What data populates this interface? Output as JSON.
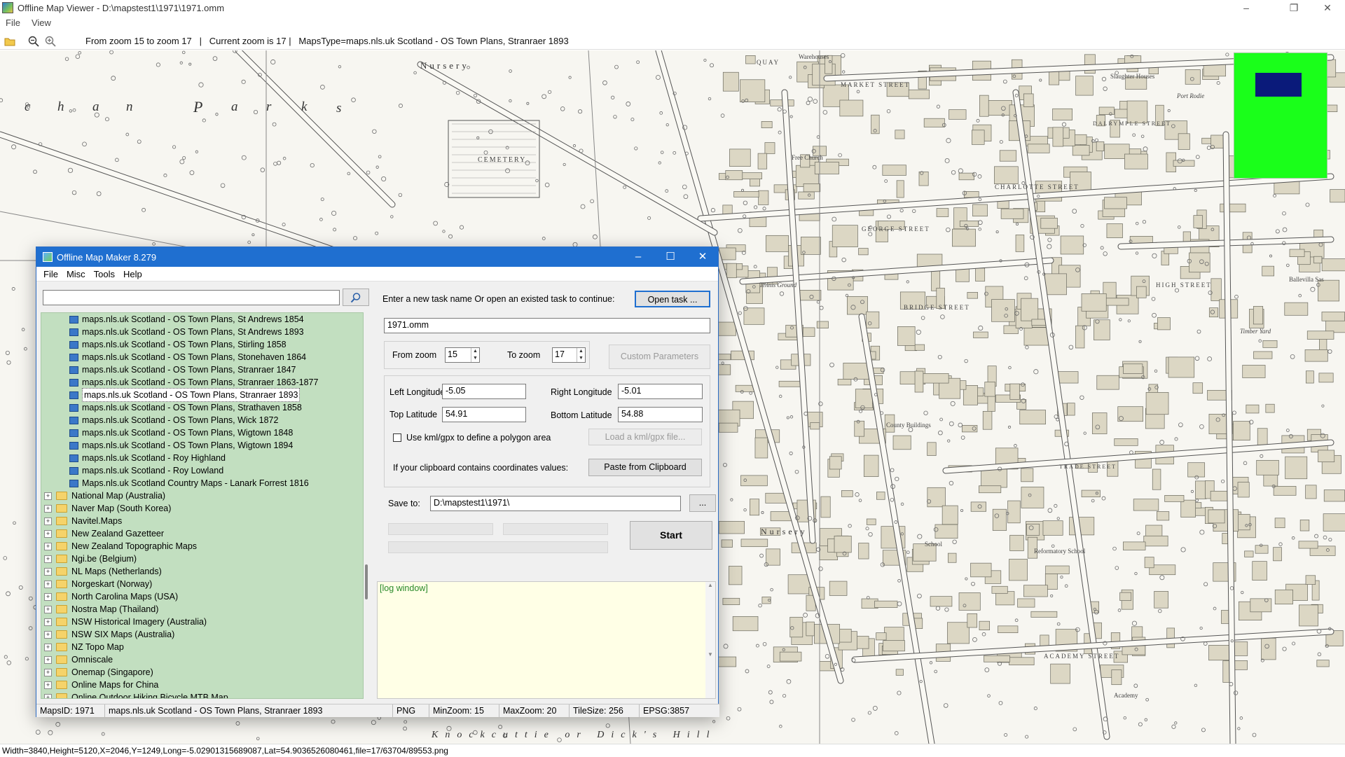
{
  "viewer": {
    "title": "Offline Map Viewer - D:\\mapstest1\\1971\\1971.omm",
    "menu": [
      "File",
      "View"
    ],
    "toolbar_info": "From zoom 15 to zoom 17   |   Current zoom is 17 |   MapsType=maps.nls.uk Scotland - OS Town Plans, Stranraer 1893",
    "status": "Width=3840,Height=5120,X=2046,Y=1249,Long=-5.02901315689087,Lat=54.9036526080461,file=17/63704/89553.png"
  },
  "map": {
    "labels": [
      "Nursery",
      "c",
      "h",
      "a",
      "n",
      "P",
      "a",
      "r",
      "k",
      "s",
      "CEMETERY",
      "Nursery",
      "Knockcuttie or Dick's Hill"
    ],
    "street_labels": [
      "QUAY",
      "MARKET STREET",
      "GEORGE STREET",
      "BRIDGE STREET",
      "CHARLOTTE STREET",
      "HIGH STREET",
      "TRADE STREET",
      "ACADEMY STREET",
      "DALRYMPLE STREET"
    ],
    "place_labels": [
      "Warehouses",
      "Slaughter Houses",
      "Port Rodie",
      "Free Church",
      "Tennis Ground",
      "Reformatory School",
      "School",
      "Academy",
      "Timber Yard",
      "County Buildings",
      "Ballevilla Sas"
    ]
  },
  "maker": {
    "title": "Offline Map Maker 8.279",
    "menu": [
      "File",
      "Misc",
      "Tools",
      "Help"
    ],
    "search_placeholder": "",
    "tree_items": [
      {
        "type": "leaf",
        "label": "maps.nls.uk Scotland - OS Town Plans, St Andrews 1854"
      },
      {
        "type": "leaf",
        "label": "maps.nls.uk Scotland - OS Town Plans, St Andrews 1893"
      },
      {
        "type": "leaf",
        "label": "maps.nls.uk Scotland - OS Town Plans, Stirling 1858"
      },
      {
        "type": "leaf",
        "label": "maps.nls.uk Scotland - OS Town Plans, Stonehaven 1864"
      },
      {
        "type": "leaf",
        "label": "maps.nls.uk Scotland - OS Town Plans, Stranraer 1847"
      },
      {
        "type": "leaf",
        "label": "maps.nls.uk Scotland - OS Town Plans, Stranraer 1863-1877"
      },
      {
        "type": "leaf",
        "label": "maps.nls.uk Scotland - OS Town Plans, Stranraer 1893",
        "selected": true
      },
      {
        "type": "leaf",
        "label": "maps.nls.uk Scotland - OS Town Plans, Strathaven 1858"
      },
      {
        "type": "leaf",
        "label": "maps.nls.uk Scotland - OS Town Plans, Wick 1872"
      },
      {
        "type": "leaf",
        "label": "maps.nls.uk Scotland - OS Town Plans, Wigtown 1848"
      },
      {
        "type": "leaf",
        "label": "maps.nls.uk Scotland - OS Town Plans, Wigtown 1894"
      },
      {
        "type": "leaf",
        "label": "maps.nls.uk Scotland - Roy Highland"
      },
      {
        "type": "leaf",
        "label": "maps.nls.uk Scotland - Roy Lowland"
      },
      {
        "type": "leaf",
        "label": "Maps.nls.uk Scotland Country Maps - Lanark Forrest 1816"
      },
      {
        "type": "folder",
        "label": "National Map (Australia)"
      },
      {
        "type": "folder",
        "label": "Naver Map (South Korea)"
      },
      {
        "type": "folder",
        "label": "Navitel.Maps"
      },
      {
        "type": "folder",
        "label": "New Zealand Gazetteer"
      },
      {
        "type": "folder",
        "label": "New Zealand Topographic Maps"
      },
      {
        "type": "folder",
        "label": "Ngi.be (Belgium)"
      },
      {
        "type": "folder",
        "label": "NL Maps (Netherlands)"
      },
      {
        "type": "folder",
        "label": "Norgeskart (Norway)"
      },
      {
        "type": "folder",
        "label": "North Carolina Maps (USA)"
      },
      {
        "type": "folder",
        "label": "Nostra Map (Thailand)"
      },
      {
        "type": "folder",
        "label": "NSW Historical Imagery (Australia)"
      },
      {
        "type": "folder",
        "label": "NSW SIX Maps (Australia)"
      },
      {
        "type": "folder",
        "label": "NZ Topo Map"
      },
      {
        "type": "folder",
        "label": "Omniscale"
      },
      {
        "type": "folder",
        "label": "Onemap (Singapore)"
      },
      {
        "type": "folder",
        "label": "Online Maps for China"
      },
      {
        "type": "folder",
        "label": "Online Outdoor Hiking Bicycle MTB Map"
      }
    ],
    "task_prompt": "Enter a new task name Or open an existed task to continue:",
    "open_task_label": "Open task ...",
    "task_name": "1971.omm",
    "from_zoom_label": "From zoom",
    "from_zoom": "15",
    "to_zoom_label": "To zoom",
    "to_zoom": "17",
    "custom_params_label": "Custom Parameters",
    "left_lon_label": "Left Longitude",
    "left_lon": "-5.05",
    "right_lon_label": "Right Longitude",
    "right_lon": "-5.01",
    "top_lat_label": "Top Latitude",
    "top_lat": "54.91",
    "bottom_lat_label": "Bottom Latitude",
    "bottom_lat": "54.88",
    "kml_checkbox_label": "Use kml/gpx to define a polygon area",
    "load_kml_label": "Load a kml/gpx file...",
    "clipboard_prompt": "If your clipboard contains coordinates values:",
    "paste_label": "Paste from Clipboard",
    "save_to_label": "Save to:",
    "save_to": "D:\\mapstest1\\1971\\",
    "browse_label": "...",
    "start_label": "Start",
    "log_text": "[log window]",
    "status": {
      "maps_id": "MapsID: 1971",
      "maps_name": "maps.nls.uk Scotland - OS Town Plans, Stranraer 1893",
      "format": "PNG",
      "min_zoom": "MinZoom: 15",
      "max_zoom": "MaxZoom: 20",
      "tile_size": "TileSize: 256",
      "epsg": "EPSG:3857"
    }
  }
}
